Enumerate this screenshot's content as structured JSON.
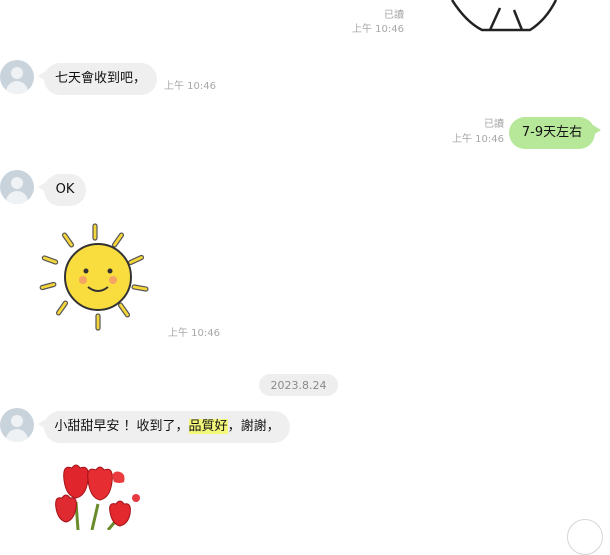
{
  "messages": [
    {
      "read": "已讀",
      "time": "上午 10:46"
    },
    {
      "text": "七天會收到吧，",
      "time": "上午 10:46"
    },
    {
      "text": "7-9天左右",
      "read": "已讀",
      "time": "上午 10:46"
    },
    {
      "text": "OK"
    },
    {
      "time": "上午 10:46"
    }
  ],
  "date_separator": "2023.8.24",
  "last_message": {
    "before": "小甜甜早安 ！收到了，",
    "highlight": "品質好",
    "after": "，謝謝，"
  },
  "colors": {
    "outgoing_bubble": "#b7e89a",
    "incoming_bubble": "#efefef",
    "highlight": "#f3f77a",
    "meta_text": "#a7a7a7"
  },
  "icons": [
    "avatar-placeholder-icon",
    "sun-sticker",
    "tulip-sticker",
    "heart-sticker"
  ]
}
